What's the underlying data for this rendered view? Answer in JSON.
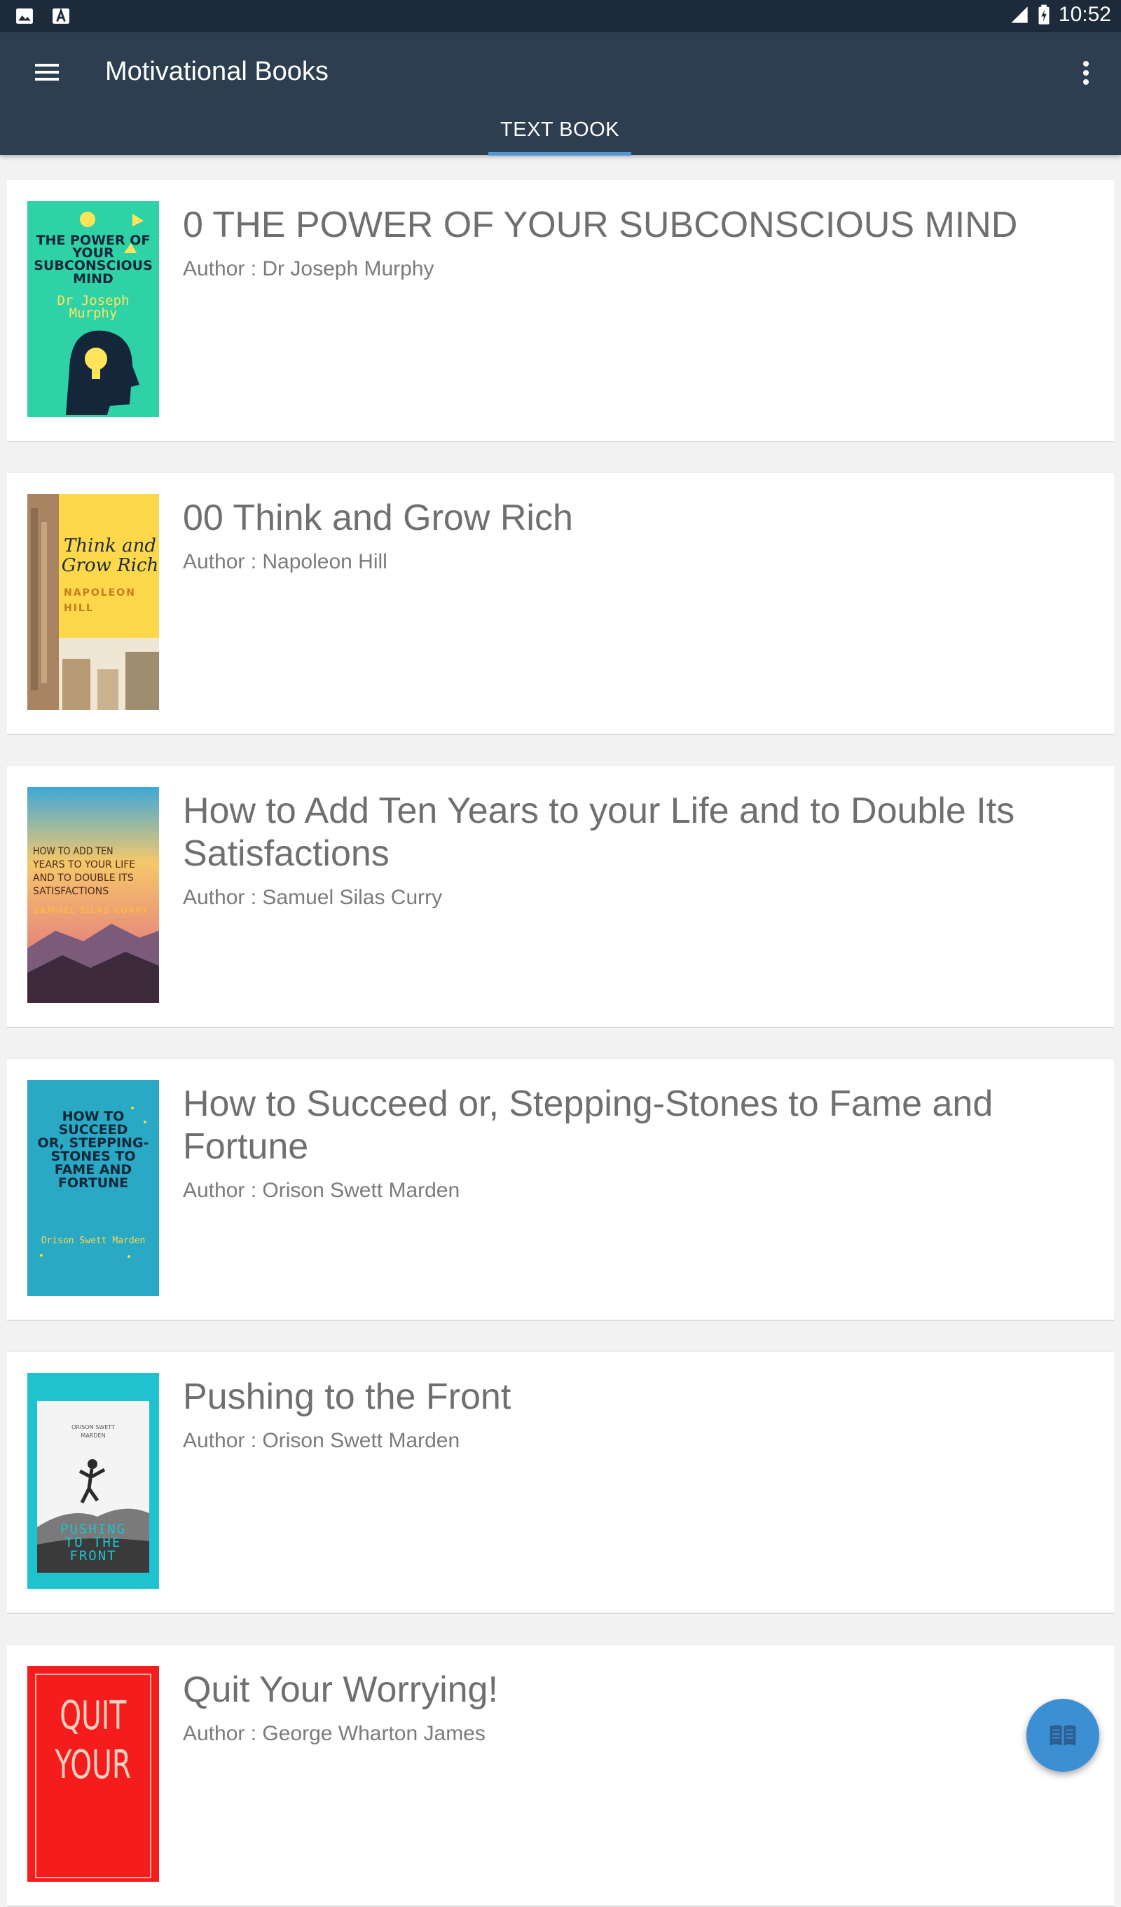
{
  "status_bar": {
    "time": "10:52"
  },
  "app_bar": {
    "title": "Motivational Books"
  },
  "tabs": [
    {
      "label": "TEXT BOOK",
      "selected": true
    }
  ],
  "books": [
    {
      "title": "0 THE POWER  OF YOUR  SUBCONSCIOUS MIND",
      "author": "Author : Dr Joseph Murphy",
      "cover": {
        "lines": [
          "THE POWER OF",
          "YOUR",
          "SUBCONSCIOUS",
          "MIND"
        ],
        "author": [
          "Dr Joseph",
          "Murphy"
        ]
      }
    },
    {
      "title": "00 Think and Grow Rich",
      "author": "Author : Napoleon Hill",
      "cover": {
        "lines": [
          "Think and",
          "Grow Rich"
        ],
        "author": [
          "NAPOLEON",
          "HILL"
        ]
      }
    },
    {
      "title": "How to Add Ten Years to your Life and to Double Its Satisfactions",
      "author": "Author : Samuel Silas Curry",
      "cover": {
        "lines": [
          "HOW TO ADD TEN",
          "YEARS TO YOUR LIFE",
          "AND TO DOUBLE ITS",
          "SATISFACTIONS"
        ],
        "author": [
          "SAMUEL SILAS CURRY"
        ]
      }
    },
    {
      "title": "How to Succeed or, Stepping-Stones to Fame and Fortune",
      "author": "Author : Orison Swett Marden",
      "cover": {
        "lines": [
          "HOW TO",
          "SUCCEED",
          "OR, STEPPING-",
          "STONES TO",
          "FAME AND",
          "FORTUNE"
        ],
        "author": [
          "Orison Swett Marden"
        ]
      }
    },
    {
      "title": "Pushing to the Front",
      "author": "Author : Orison Swett Marden",
      "cover": {
        "lines": [
          "PUSHING",
          "TO THE",
          "FRONT"
        ],
        "author": [
          "ORISON SWETT",
          "MARDEN"
        ]
      }
    },
    {
      "title": "Quit Your Worrying!",
      "author": "Author : George Wharton James",
      "cover": {
        "lines": [
          "QUIT",
          "YOUR"
        ],
        "author": []
      }
    }
  ],
  "icons": {
    "status_left": [
      "image-icon",
      "a-icon"
    ],
    "status_right": [
      "signal-icon",
      "battery-icon"
    ],
    "menu": "hamburger-menu-icon",
    "overflow": "more-vert-icon",
    "fab": "open-book-icon"
  },
  "colors": {
    "status_bar": "#1d2a3a",
    "app_bar": "#2c3e50",
    "tab_indicator": "#4f97d6",
    "fab": "#3d8fd3",
    "title_text": "#6f6f6f"
  }
}
